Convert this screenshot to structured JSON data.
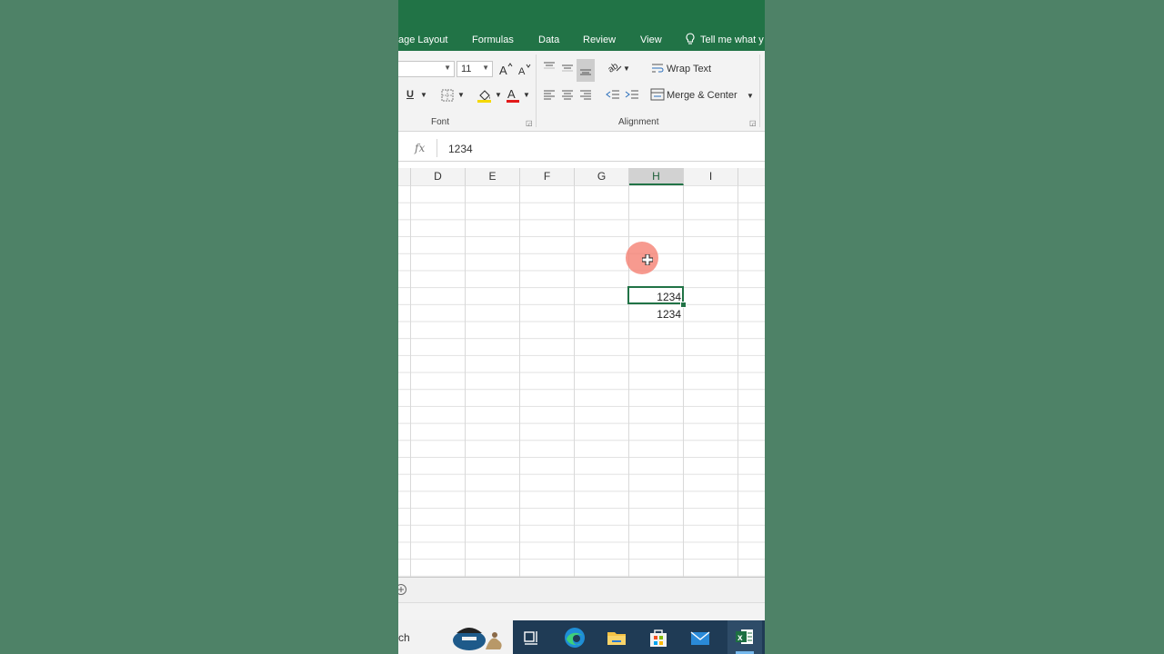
{
  "ribbon_tabs": [
    {
      "label": "age Layout"
    },
    {
      "label": "Formulas"
    },
    {
      "label": "Data"
    },
    {
      "label": "Review"
    },
    {
      "label": "View"
    },
    {
      "label": "Tell me what y"
    }
  ],
  "font_group": {
    "font_name": "",
    "font_size": "11",
    "underline_label": "U",
    "label": "Font"
  },
  "alignment_group": {
    "wrap_text": "Wrap Text",
    "merge_center": "Merge & Center",
    "label": "Alignment"
  },
  "formula_bar": {
    "fx_label": "fx",
    "value": "1234"
  },
  "columns": [
    "D",
    "E",
    "F",
    "G",
    "H",
    "I",
    ""
  ],
  "active_column": "H",
  "cells": {
    "h_selected": "1234",
    "h_below": "1234"
  },
  "taskbar": {
    "search_text": "ch"
  },
  "colors": {
    "accent": "#217346",
    "background": "#4e8267"
  },
  "icons": [
    "increase-font-icon",
    "decrease-font-icon",
    "borders-icon",
    "fill-color-icon",
    "font-color-icon",
    "align-icons",
    "orientation-icon",
    "indent-icons",
    "wrap-icon",
    "merge-icon",
    "add-sheet-icon",
    "task-view-icon",
    "edge-icon",
    "file-explorer-icon",
    "store-icon",
    "mail-icon",
    "excel-icon"
  ]
}
